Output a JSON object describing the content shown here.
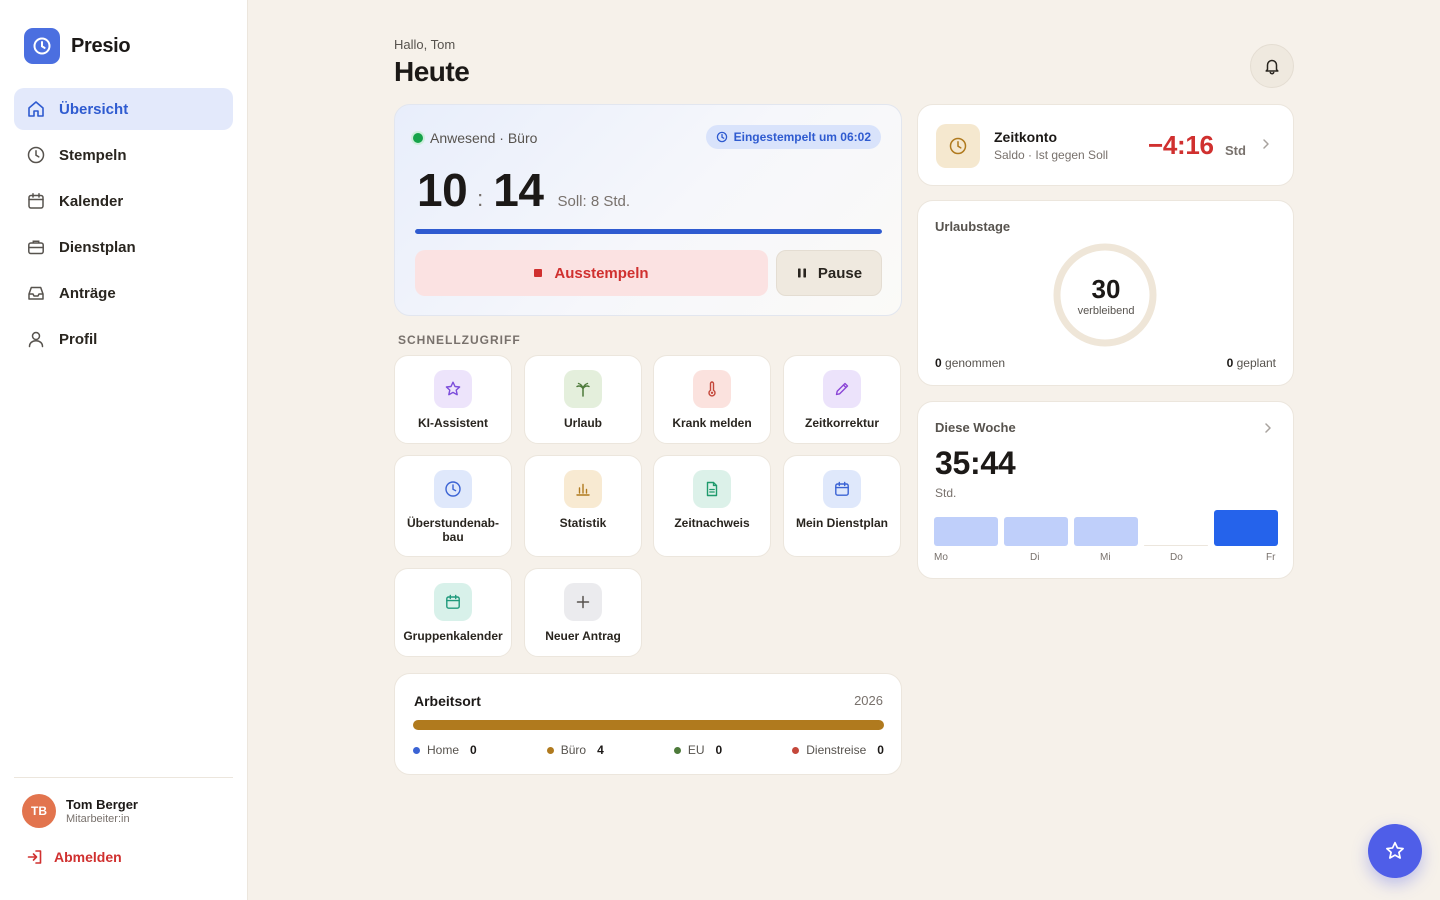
{
  "app": {
    "name": "Presio",
    "accent": "#4b6fe0"
  },
  "sidebar": {
    "items": [
      {
        "label": "Übersicht",
        "icon": "home-icon",
        "active": true
      },
      {
        "label": "Stempeln",
        "icon": "clock-icon"
      },
      {
        "label": "Kalender",
        "icon": "calendar-icon"
      },
      {
        "label": "Dienstplan",
        "icon": "briefcase-icon"
      },
      {
        "label": "Anträge",
        "icon": "inbox-icon"
      },
      {
        "label": "Profil",
        "icon": "user-icon"
      }
    ],
    "user": {
      "initials": "TB",
      "name": "Tom Berger",
      "role": "Mitarbeiter:in"
    },
    "logout_label": "Abmelden"
  },
  "header": {
    "greeting": "Hallo, Tom",
    "title": "Heute"
  },
  "clock": {
    "status": "Anwesend · Büro",
    "stamped_in": "Eingestempelt um 06:02",
    "hours": "10",
    "separator": ":",
    "minutes": "14",
    "target": "Soll: 8 Std.",
    "progress_percent": 100,
    "stop_label": "Ausstempeln",
    "pause_label": "Pause"
  },
  "quick_access": {
    "label": "SCHNELLZUGRIFF",
    "tiles": [
      {
        "label": "KI-Assistent",
        "icon": "star-icon",
        "bg": "#ede4fb",
        "fg": "#7c4ddb"
      },
      {
        "label": "Urlaub",
        "icon": "palm-tree-icon",
        "bg": "#e4efdc",
        "fg": "#4d7a3a"
      },
      {
        "label": "Krank melden",
        "icon": "thermometer-icon",
        "bg": "#fbe2de",
        "fg": "#c4473a"
      },
      {
        "label": "Zeitkorrektur",
        "icon": "pencil-icon",
        "bg": "#ece3fb",
        "fg": "#8a45d6"
      },
      {
        "label": "Überstundenab-bau",
        "icon": "clock-icon",
        "bg": "#dfe8fb",
        "fg": "#3b63d4"
      },
      {
        "label": "Statistik",
        "icon": "bar-chart-icon",
        "bg": "#f8ead2",
        "fg": "#b07a1e"
      },
      {
        "label": "Zeitnachweis",
        "icon": "document-icon",
        "bg": "#dcf1e9",
        "fg": "#1f9a6c"
      },
      {
        "label": "Mein Dienstplan",
        "icon": "calendar-icon",
        "bg": "#dfe8fb",
        "fg": "#3b63d4"
      },
      {
        "label": "Gruppenkalender",
        "icon": "calendar-icon",
        "bg": "#d8f1ea",
        "fg": "#1f9a7c"
      },
      {
        "label": "Neuer Antrag",
        "icon": "plus-icon",
        "bg": "#ebebee",
        "fg": "#57534e"
      }
    ]
  },
  "workplace": {
    "title": "Arbeitsort",
    "year": "2026",
    "legend": [
      {
        "label": "Home",
        "value": "0",
        "color": "#3b63d4"
      },
      {
        "label": "Büro",
        "value": "4",
        "color": "#b07a1e"
      },
      {
        "label": "EU",
        "value": "0",
        "color": "#4d7a3a"
      },
      {
        "label": "Dienstreise",
        "value": "0",
        "color": "#c4473a"
      }
    ]
  },
  "time_account": {
    "title": "Zeitkonto",
    "subtitle": "Saldo · Ist gegen Soll",
    "value": "−4:16",
    "unit": "Std"
  },
  "vacation": {
    "title": "Urlaubstage",
    "remaining": "30",
    "remaining_label": "verbleibend",
    "taken": "0",
    "taken_label": "genommen",
    "planned": "0",
    "planned_label": "geplant"
  },
  "week": {
    "title": "Diese Woche",
    "total": "35:44",
    "unit": "Std.",
    "days": [
      {
        "label": "Mo",
        "level": 0.72,
        "color": "#bfcffa"
      },
      {
        "label": "Di",
        "level": 0.72,
        "color": "#bfcffa"
      },
      {
        "label": "Mi",
        "level": 0.72,
        "color": "#bfcffa"
      },
      {
        "label": "Do",
        "level": 0,
        "color": "#bfcffa"
      },
      {
        "label": "Fr",
        "level": 0.9,
        "color": "#2563eb"
      }
    ]
  }
}
